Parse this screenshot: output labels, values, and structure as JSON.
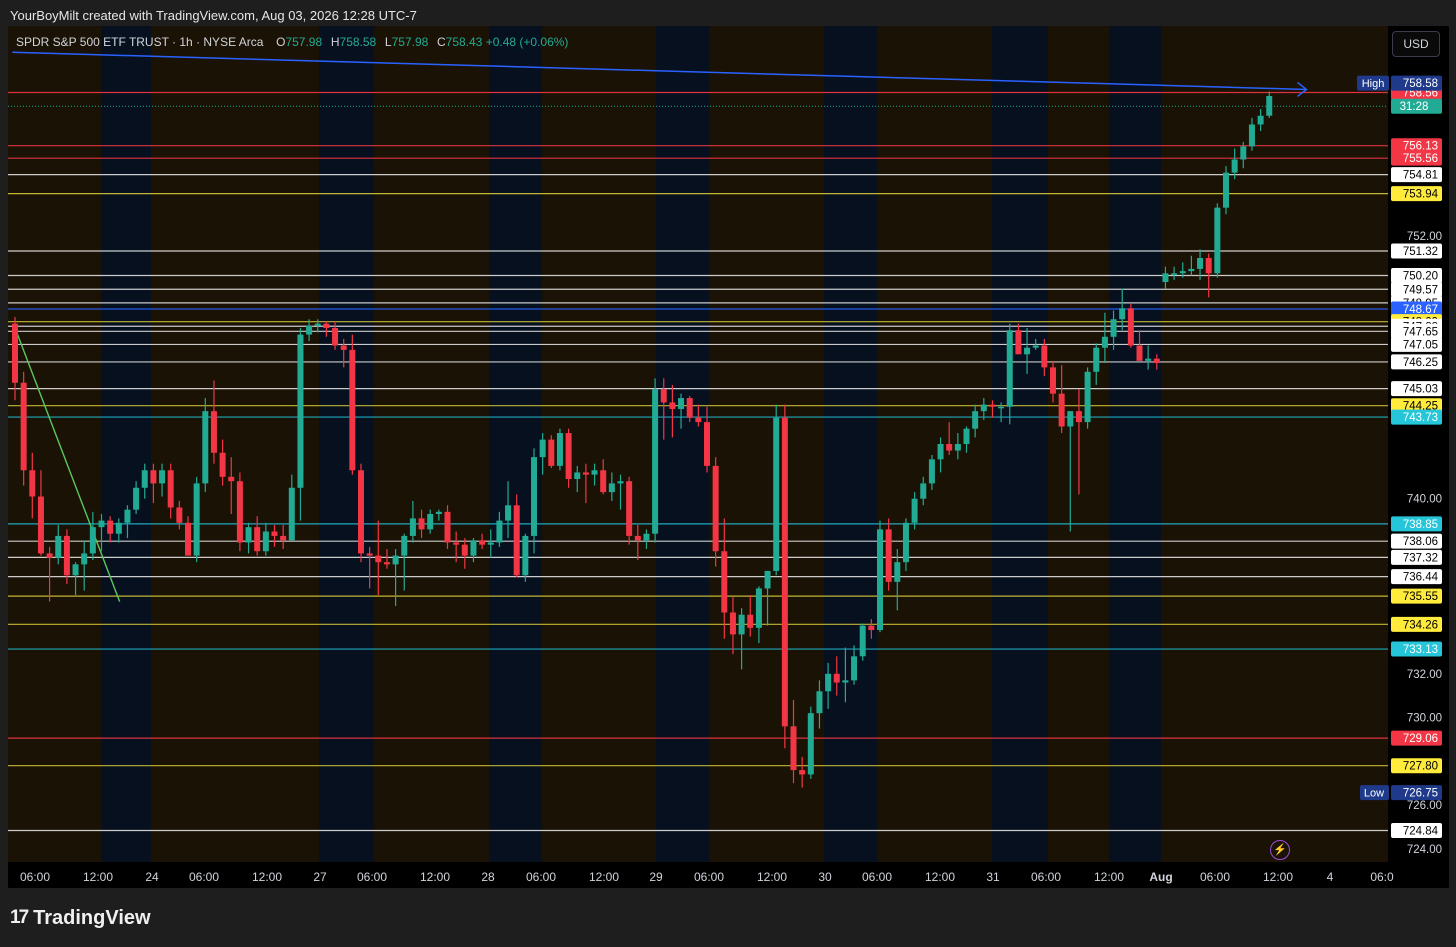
{
  "caption": "YourBoyMilt created with TradingView.com, Aug 03, 2026 12:28 UTC-7",
  "legend": {
    "symbol": "SPDR S&P 500 ETF TRUST · 1h · NYSE Arca",
    "o_label": "O",
    "o_value": "757.98",
    "h_label": "H",
    "h_value": "758.58",
    "l_label": "L",
    "l_value": "757.98",
    "c_label": "C",
    "c_value": "758.43",
    "change": "+0.48 (+0.06%)"
  },
  "currency_button": "USD",
  "brand": "TradingView",
  "colors": {
    "bull": "#22ab94",
    "bear": "#f23645",
    "orange_session": "#1a1205",
    "blue_session": "#07101f",
    "white_level": "#e0e0e0",
    "yellow_level": "#d6c93b",
    "cyan_level": "#22b8cf",
    "red_level": "#f23645",
    "blue_level": "#2962ff"
  },
  "chart_data": {
    "type": "candlestick",
    "timeframe": "1h",
    "ylim": [
      723.4,
      761.6
    ],
    "y_ticks": [
      "724.00",
      "726.00",
      "730.00",
      "732.00",
      "740.00",
      "752.00",
      "758.00"
    ],
    "x_ticks": [
      "06:00",
      "12:00",
      "24",
      "06:00",
      "12:00",
      "27",
      "06:00",
      "12:00",
      "28",
      "06:00",
      "12:00",
      "29",
      "06:00",
      "12:00",
      "30",
      "06:00",
      "12:00",
      "31",
      "06:00",
      "12:00",
      "Aug",
      "06:00",
      "12:00",
      "4",
      "06:0"
    ],
    "bold_x_ticks": [
      "Aug"
    ],
    "horizontal_levels": [
      {
        "price": 758.56,
        "label": "758.56",
        "style": "red"
      },
      {
        "price": 756.13,
        "label": "756.13",
        "style": "red"
      },
      {
        "price": 755.56,
        "label": "755.56",
        "style": "red"
      },
      {
        "price": 754.81,
        "label": "754.81",
        "style": "white"
      },
      {
        "price": 753.94,
        "label": "753.94",
        "style": "yellow"
      },
      {
        "price": 751.32,
        "label": "751.32",
        "style": "white"
      },
      {
        "price": 750.2,
        "label": "750.20",
        "style": "white"
      },
      {
        "price": 749.57,
        "label": "749.57",
        "style": "white"
      },
      {
        "price": 748.95,
        "label": "748.95",
        "style": "white"
      },
      {
        "price": 748.67,
        "label": "748.67",
        "style": "blue"
      },
      {
        "price": 748.09,
        "label": "748.09",
        "style": "yellow"
      },
      {
        "price": 747.88,
        "label": "747.88",
        "style": "white"
      },
      {
        "price": 747.65,
        "label": "747.65",
        "style": "white"
      },
      {
        "price": 747.05,
        "label": "747.05",
        "style": "white"
      },
      {
        "price": 746.25,
        "label": "746.25",
        "style": "white"
      },
      {
        "price": 745.03,
        "label": "745.03",
        "style": "white"
      },
      {
        "price": 744.25,
        "label": "744.25",
        "style": "yellow"
      },
      {
        "price": 743.73,
        "label": "743.73",
        "style": "cyan"
      },
      {
        "price": 738.85,
        "label": "738.85",
        "style": "cyan"
      },
      {
        "price": 738.06,
        "label": "738.06",
        "style": "white"
      },
      {
        "price": 737.32,
        "label": "737.32",
        "style": "white"
      },
      {
        "price": 736.44,
        "label": "736.44",
        "style": "white"
      },
      {
        "price": 735.55,
        "label": "735.55",
        "style": "yellow"
      },
      {
        "price": 734.26,
        "label": "734.26",
        "style": "yellow"
      },
      {
        "price": 733.13,
        "label": "733.13",
        "style": "cyan"
      },
      {
        "price": 729.06,
        "label": "729.06",
        "style": "red"
      },
      {
        "price": 727.8,
        "label": "727.80",
        "style": "yellow"
      },
      {
        "price": 724.84,
        "label": "724.84",
        "style": "white"
      }
    ],
    "high_marker": {
      "label": "High",
      "value": "758.58",
      "price": 758.58
    },
    "low_marker": {
      "label": "Low",
      "value": "726.75",
      "price": 726.75
    },
    "countdown": {
      "text": "31:28",
      "price": 757.98
    },
    "candles": [
      [
        748.0,
        748.3,
        744.5,
        745.3
      ],
      [
        745.3,
        745.8,
        740.6,
        741.3
      ],
      [
        741.3,
        742.1,
        739.1,
        740.1
      ],
      [
        740.1,
        741.3,
        737.4,
        737.5
      ],
      [
        737.5,
        737.8,
        735.3,
        737.3
      ],
      [
        737.3,
        738.8,
        737.0,
        738.3
      ],
      [
        738.3,
        738.6,
        736.1,
        736.5
      ],
      [
        736.5,
        737.1,
        735.6,
        737.0
      ],
      [
        737.0,
        738.1,
        735.8,
        737.5
      ],
      [
        737.5,
        739.4,
        737.2,
        738.7
      ],
      [
        738.7,
        739.3,
        737.6,
        739.0
      ],
      [
        739.0,
        739.2,
        738.0,
        738.4
      ],
      [
        738.4,
        739.1,
        738.0,
        738.9
      ],
      [
        738.9,
        739.7,
        738.2,
        739.5
      ],
      [
        739.5,
        740.8,
        739.3,
        740.5
      ],
      [
        740.5,
        741.6,
        740.0,
        741.3
      ],
      [
        741.3,
        741.6,
        739.8,
        740.7
      ],
      [
        740.7,
        741.6,
        740.1,
        741.3
      ],
      [
        741.3,
        741.6,
        739.1,
        739.6
      ],
      [
        739.6,
        739.9,
        738.6,
        738.9
      ],
      [
        738.9,
        739.2,
        737.4,
        737.4
      ],
      [
        737.4,
        741.0,
        737.1,
        740.7
      ],
      [
        740.7,
        744.6,
        740.3,
        744.0
      ],
      [
        744.0,
        745.4,
        741.6,
        742.1
      ],
      [
        742.1,
        742.7,
        740.6,
        741.0
      ],
      [
        741.0,
        741.9,
        739.3,
        740.8
      ],
      [
        740.8,
        741.2,
        737.6,
        738.0
      ],
      [
        738.0,
        738.9,
        737.5,
        738.7
      ],
      [
        738.7,
        739.2,
        737.4,
        737.6
      ],
      [
        737.6,
        738.9,
        737.4,
        738.5
      ],
      [
        738.5,
        738.8,
        737.8,
        738.3
      ],
      [
        738.3,
        738.8,
        737.7,
        738.1
      ],
      [
        738.1,
        741.1,
        739.0,
        740.5
      ],
      [
        740.5,
        747.8,
        739.0,
        747.5
      ],
      [
        747.5,
        748.2,
        747.2,
        747.9
      ],
      [
        747.9,
        748.2,
        747.6,
        748.0
      ],
      [
        748.0,
        748.1,
        747.4,
        747.8
      ],
      [
        747.8,
        748.1,
        746.8,
        747.0
      ],
      [
        747.0,
        747.3,
        746.0,
        746.8
      ],
      [
        746.8,
        747.5,
        741.1,
        741.3
      ],
      [
        741.3,
        741.6,
        737.1,
        737.5
      ],
      [
        737.5,
        737.8,
        735.9,
        737.4
      ],
      [
        737.4,
        739.0,
        735.6,
        737.1
      ],
      [
        737.1,
        737.7,
        736.8,
        737.0
      ],
      [
        737.0,
        737.7,
        735.1,
        737.4
      ],
      [
        737.4,
        738.4,
        735.8,
        738.3
      ],
      [
        738.3,
        739.9,
        738.0,
        739.1
      ],
      [
        739.1,
        739.5,
        738.2,
        738.6
      ],
      [
        738.6,
        739.5,
        738.4,
        739.3
      ],
      [
        739.3,
        739.5,
        739.0,
        739.4
      ],
      [
        739.4,
        739.7,
        737.7,
        738.0
      ],
      [
        738.0,
        738.5,
        737.1,
        737.9
      ],
      [
        737.9,
        738.2,
        736.8,
        737.4
      ],
      [
        737.4,
        738.2,
        737.1,
        738.1
      ],
      [
        738.1,
        738.4,
        737.7,
        737.9
      ],
      [
        737.9,
        738.6,
        737.3,
        738.0
      ],
      [
        738.0,
        739.4,
        737.8,
        739.0
      ],
      [
        739.0,
        740.8,
        738.2,
        739.7
      ],
      [
        739.7,
        740.2,
        736.4,
        736.5
      ],
      [
        736.5,
        738.4,
        736.2,
        738.3
      ],
      [
        738.3,
        742.3,
        737.5,
        741.9
      ],
      [
        741.9,
        743.0,
        741.1,
        742.7
      ],
      [
        742.7,
        742.9,
        741.4,
        741.5
      ],
      [
        741.5,
        743.2,
        741.3,
        743.0
      ],
      [
        743.0,
        743.2,
        740.5,
        740.9
      ],
      [
        740.9,
        741.5,
        740.3,
        741.2
      ],
      [
        741.2,
        741.6,
        739.8,
        741.1
      ],
      [
        741.1,
        741.6,
        740.6,
        741.3
      ],
      [
        741.3,
        741.8,
        740.2,
        740.3
      ],
      [
        740.3,
        741.2,
        739.9,
        740.7
      ],
      [
        740.7,
        741.1,
        739.5,
        740.8
      ],
      [
        740.8,
        741.0,
        737.9,
        738.3
      ],
      [
        738.3,
        738.8,
        737.2,
        738.1
      ],
      [
        738.1,
        738.6,
        737.7,
        738.4
      ],
      [
        738.4,
        745.5,
        738.0,
        745.0
      ],
      [
        745.0,
        745.5,
        742.7,
        744.4
      ],
      [
        744.4,
        745.2,
        742.8,
        744.1
      ],
      [
        744.1,
        744.8,
        743.2,
        744.6
      ],
      [
        744.6,
        744.7,
        743.5,
        743.7
      ],
      [
        743.7,
        744.3,
        743.3,
        743.5
      ],
      [
        743.5,
        744.2,
        741.2,
        741.5
      ],
      [
        741.5,
        741.9,
        736.9,
        737.6
      ],
      [
        737.6,
        739.1,
        733.6,
        734.8
      ],
      [
        734.8,
        735.5,
        732.9,
        733.8
      ],
      [
        733.8,
        735.0,
        732.2,
        734.7
      ],
      [
        734.7,
        735.6,
        733.7,
        734.1
      ],
      [
        734.1,
        736.0,
        733.4,
        735.9
      ],
      [
        735.9,
        736.7,
        734.2,
        736.7
      ],
      [
        736.7,
        744.3,
        736.5,
        743.7
      ],
      [
        743.7,
        744.3,
        728.6,
        729.6
      ],
      [
        729.6,
        730.8,
        727.0,
        727.6
      ],
      [
        727.6,
        728.2,
        726.8,
        727.4
      ],
      [
        727.4,
        730.5,
        727.2,
        730.2
      ],
      [
        730.2,
        731.7,
        729.5,
        731.2
      ],
      [
        731.2,
        732.5,
        730.4,
        732.0
      ],
      [
        732.0,
        732.8,
        731.0,
        731.6
      ],
      [
        731.6,
        733.2,
        730.7,
        731.7
      ],
      [
        731.7,
        733.3,
        731.5,
        732.8
      ],
      [
        732.8,
        734.3,
        732.6,
        734.2
      ],
      [
        734.2,
        734.5,
        733.6,
        734.0
      ],
      [
        734.0,
        739.0,
        733.9,
        738.6
      ],
      [
        738.6,
        739.1,
        735.8,
        736.2
      ],
      [
        736.2,
        737.7,
        734.9,
        737.1
      ],
      [
        737.1,
        739.1,
        736.7,
        738.9
      ],
      [
        738.9,
        740.3,
        738.6,
        740.0
      ],
      [
        740.0,
        741.0,
        739.7,
        740.7
      ],
      [
        740.7,
        742.0,
        740.4,
        741.8
      ],
      [
        741.8,
        742.8,
        741.2,
        742.5
      ],
      [
        742.5,
        743.5,
        742.0,
        742.2
      ],
      [
        742.2,
        743.0,
        741.8,
        742.5
      ],
      [
        742.5,
        743.3,
        742.1,
        743.2
      ],
      [
        743.2,
        744.3,
        742.8,
        744.0
      ],
      [
        744.0,
        744.6,
        743.6,
        744.3
      ],
      [
        744.3,
        744.5,
        743.7,
        744.2
      ],
      [
        744.2,
        744.4,
        743.5,
        744.2
      ],
      [
        744.2,
        748.0,
        743.4,
        747.7
      ],
      [
        747.7,
        748.0,
        746.6,
        746.6
      ],
      [
        746.6,
        747.8,
        745.7,
        746.9
      ],
      [
        746.9,
        747.3,
        746.8,
        747.0
      ],
      [
        747.0,
        747.3,
        745.6,
        746.0
      ],
      [
        746.0,
        746.3,
        744.4,
        744.8
      ],
      [
        744.8,
        746.1,
        743.0,
        743.3
      ],
      [
        743.3,
        744.0,
        738.5,
        744.0
      ],
      [
        744.0,
        745.0,
        740.2,
        743.5
      ],
      [
        743.5,
        746.0,
        743.2,
        745.8
      ],
      [
        745.8,
        747.1,
        745.2,
        746.9
      ],
      [
        746.9,
        748.5,
        746.2,
        747.4
      ],
      [
        747.4,
        748.6,
        746.8,
        748.2
      ],
      [
        748.2,
        749.6,
        747.7,
        748.7
      ],
      [
        748.7,
        748.9,
        746.9,
        747.0
      ],
      [
        747.0,
        747.7,
        746.7,
        746.3
      ],
      [
        746.3,
        747.0,
        745.9,
        746.4
      ],
      [
        746.4,
        746.6,
        745.9,
        746.2
      ],
      [
        749.9,
        750.6,
        749.6,
        750.3
      ],
      [
        750.3,
        750.6,
        750.0,
        750.3
      ],
      [
        750.3,
        750.8,
        750.1,
        750.4
      ],
      [
        750.4,
        751.1,
        750.2,
        750.5
      ],
      [
        750.5,
        751.4,
        750.0,
        751.0
      ],
      [
        751.0,
        751.2,
        749.2,
        750.3
      ],
      [
        750.3,
        753.5,
        750.1,
        753.3
      ],
      [
        753.3,
        755.2,
        753.0,
        754.9
      ],
      [
        754.9,
        756.0,
        754.6,
        755.5
      ],
      [
        755.5,
        756.3,
        755.1,
        756.1
      ],
      [
        756.1,
        757.4,
        755.9,
        757.1
      ],
      [
        757.1,
        757.8,
        756.8,
        757.5
      ],
      [
        757.5,
        758.6,
        757.4,
        758.4
      ]
    ],
    "trendlines": [
      {
        "name": "blue",
        "from": {
          "bar": -0.3,
          "price": 760.4
        },
        "to": {
          "bar": 149.3,
          "price": 758.7
        }
      },
      {
        "name": "green",
        "from": {
          "bar": 0.2,
          "price": 747.6
        },
        "to": {
          "bar": 12.1,
          "price": 735.3
        }
      }
    ]
  }
}
